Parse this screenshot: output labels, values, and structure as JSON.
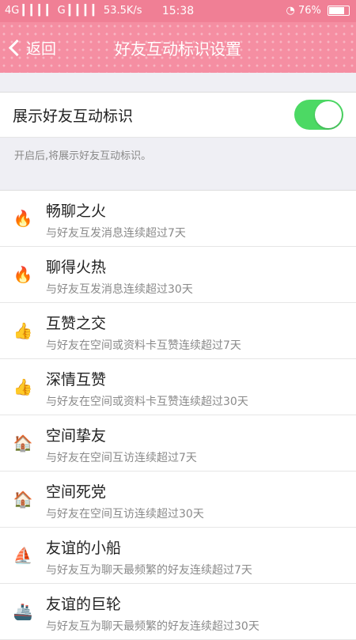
{
  "status_bar": {
    "left": "4G ▎▎▎▎ G ▎▎▎▎ 53.5K/s",
    "time": "15:38",
    "battery": "76%"
  },
  "header": {
    "back_label": "返回",
    "title": "好友互动标识设置"
  },
  "toggle": {
    "label": "展示好友互动标识",
    "enabled": true
  },
  "hint": "开启后,将展示好友互动标识。",
  "items": [
    {
      "icon": "flame-small-icon",
      "glyph": "🔥",
      "title": "畅聊之火",
      "desc": "与好友互发消息连续超过7天"
    },
    {
      "icon": "flame-big-icon",
      "glyph": "🔥",
      "title": "聊得火热",
      "desc": "与好友互发消息连续超过30天"
    },
    {
      "icon": "thumbs-up-icon",
      "glyph": "👍",
      "title": "互赞之交",
      "desc": "与好友在空间或资料卡互赞连续超过7天"
    },
    {
      "icon": "thumbs-heart-icon",
      "glyph": "👍",
      "title": "深情互赞",
      "desc": "与好友在空间或资料卡互赞连续超过30天"
    },
    {
      "icon": "house-icon",
      "glyph": "🏠",
      "title": "空间挚友",
      "desc": "与好友在空间互访连续超过7天"
    },
    {
      "icon": "house-bright-icon",
      "glyph": "🏠",
      "title": "空间死党",
      "desc": "与好友在空间互访连续超过30天"
    },
    {
      "icon": "sailboat-icon",
      "glyph": "⛵",
      "title": "友谊的小船",
      "desc": "与好友互为聊天最频繁的好友连续超过7天"
    },
    {
      "icon": "ship-icon",
      "glyph": "🚢",
      "title": "友谊的巨轮",
      "desc": "与好友互为聊天最频繁的好友连续超过30天"
    }
  ],
  "colors": {
    "header_bg": "#f58ea2",
    "toggle_on": "#4cd964"
  }
}
